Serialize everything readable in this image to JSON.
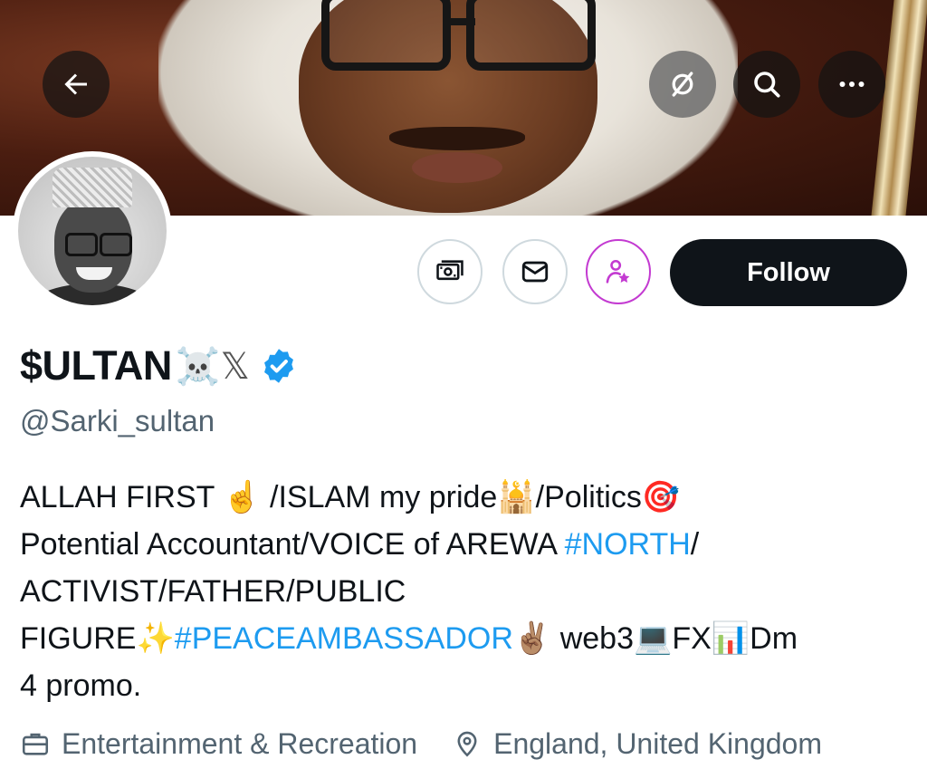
{
  "header": {
    "back_icon": "arrow-left-icon",
    "grok_icon": "slashed-circle-icon",
    "search_icon": "search-icon",
    "more_icon": "more-dots-icon"
  },
  "actions": {
    "tip_icon": "money-icon",
    "message_icon": "envelope-icon",
    "subscribe_icon": "person-star-icon",
    "follow_label": "Follow"
  },
  "profile": {
    "display_name": "$ULTAN",
    "name_emoji": "☠️𝕏",
    "handle": "@Sarki_sultan",
    "verified": true,
    "bio": {
      "line1_a": "ALLAH FIRST ",
      "line1_e1": "☝️",
      "line1_b": " /ISLAM my pride",
      "line1_e2": "🕌",
      "line1_c": "/Politics",
      "line1_e3": "🎯",
      "line2_a": "Potential Accountant/VOICE of AREWA ",
      "line2_tag": "#NORTH",
      "line2_b": "/",
      "line3": "ACTIVIST/FATHER/PUBLIC",
      "line4_a": "FIGURE",
      "line4_e1": "✨",
      "line4_tag": "#PEACEAMBASSADOR",
      "line4_e2": "✌🏽",
      "line4_b": " web3",
      "line4_e3": "💻",
      "line4_c": "FX",
      "line4_e4": "📊",
      "line4_d": "Dm",
      "line5": "4 promo."
    },
    "category": "Entertainment & Recreation",
    "location": "England, United Kingdom"
  },
  "colors": {
    "accent": "#1d9bf0",
    "secondary_text": "#536471",
    "subscribe_purple": "#c33ad1",
    "follow_bg": "#0f1419"
  }
}
